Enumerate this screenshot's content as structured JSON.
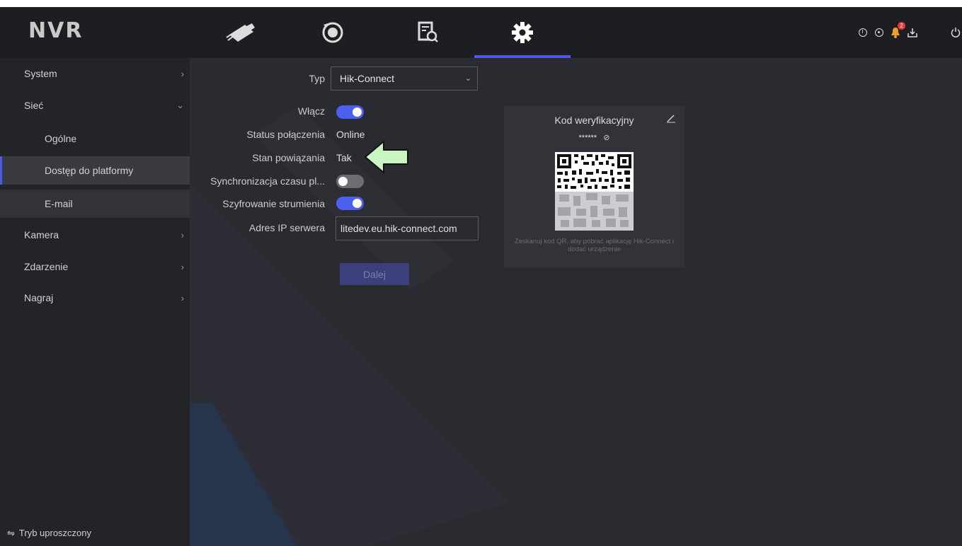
{
  "app": {
    "logo": "NVR"
  },
  "main_tabs": [
    {
      "name": "live-view",
      "icon": "camera-icon"
    },
    {
      "name": "playback",
      "icon": "playback-icon"
    },
    {
      "name": "search",
      "icon": "file-search-icon"
    },
    {
      "name": "configuration",
      "icon": "gear-icon",
      "active": true
    }
  ],
  "top_right": {
    "icons": [
      "info-icon",
      "target-icon",
      "alarm-bell-icon",
      "download-icon",
      "power-icon"
    ],
    "alarm_badge": "2"
  },
  "sidebar": {
    "items": [
      {
        "label": "System",
        "chevron": "›"
      },
      {
        "label": "Sieć",
        "chevron": "⌄"
      },
      {
        "label": "Ogólne"
      },
      {
        "label": "Dostęp do platformy"
      },
      {
        "label": "E-mail"
      },
      {
        "label": "Kamera",
        "chevron": "›"
      },
      {
        "label": "Zdarzenie",
        "chevron": "›"
      },
      {
        "label": "Nagraj",
        "chevron": "›"
      }
    ],
    "simple_mode": {
      "icon": "⇋",
      "label": "Tryb uproszczony"
    }
  },
  "form": {
    "type": {
      "label": "Typ",
      "value": "Hik-Connect"
    },
    "enable": {
      "label": "Włącz",
      "on": true
    },
    "connection_status": {
      "label": "Status połączenia",
      "value": "Online"
    },
    "binding_state": {
      "label": "Stan powiązania",
      "value": "Tak"
    },
    "time_sync": {
      "label": "Synchronizacja czasu pl...",
      "on": false
    },
    "stream_encryption": {
      "label": "Szyfrowanie strumienia",
      "on": true
    },
    "server_ip": {
      "label": "Adres IP serwera",
      "value": "litedev.eu.hik-connect.com"
    },
    "next_button": "Dalej"
  },
  "qr_card": {
    "title": "Kod weryfikacyjny",
    "code_masked": "******",
    "hint": "Zeskanuj kod QR, aby pobrać aplikację Hik-Connect i dodać urządzenie"
  },
  "colors": {
    "accent": "#4a5ae8",
    "background": "#2a2b30",
    "topbar": "#1d1e21",
    "sidebar": "#232428",
    "arrow_annotation": "#c8f5c0"
  }
}
